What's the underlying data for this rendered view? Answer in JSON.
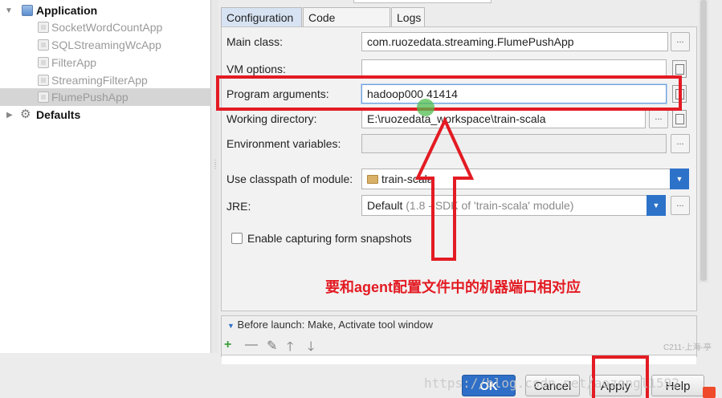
{
  "tree": {
    "root_label": "Application",
    "items": [
      {
        "label": "SocketWordCountApp"
      },
      {
        "label": "SQLStreamingWcApp"
      },
      {
        "label": "FilterApp"
      },
      {
        "label": "StreamingFilterApp"
      },
      {
        "label": "FlumePushApp"
      }
    ],
    "defaults_label": "Defaults"
  },
  "tabs": [
    {
      "label": "Configuration"
    },
    {
      "label": "Code Coverage"
    },
    {
      "label": "Logs"
    }
  ],
  "form": {
    "main_class_label": "Main class:",
    "main_class_value": "com.ruozedata.streaming.FlumePushApp",
    "vm_options_label": "VM options:",
    "vm_options_value": "",
    "program_args_label": "Program arguments:",
    "program_args_value": "hadoop000 41414",
    "working_dir_label": "Working directory:",
    "working_dir_value": "E:\\ruozedata_workspace\\train-scala",
    "env_vars_label": "Environment variables:",
    "env_vars_value": "",
    "classpath_label": "Use classpath of module:",
    "classpath_value": "train-scala",
    "jre_label": "JRE:",
    "jre_value": "Default",
    "jre_detail": "(1.8 - SDK of 'train-scala' module)",
    "snapshot_label": "Enable capturing form snapshots",
    "dots": "..."
  },
  "before_launch": {
    "label": "Before launch: Make, Activate tool window"
  },
  "buttons": {
    "ok": "OK",
    "cancel": "Cancel",
    "apply": "Apply",
    "help": "Help"
  },
  "annotation": {
    "note": "要和agent配置文件中的机器端口相对应",
    "color": "#e31b23"
  },
  "watermark": "https://blog.csdn.net/aozongl1592",
  "tag": "C211-上海-亭"
}
